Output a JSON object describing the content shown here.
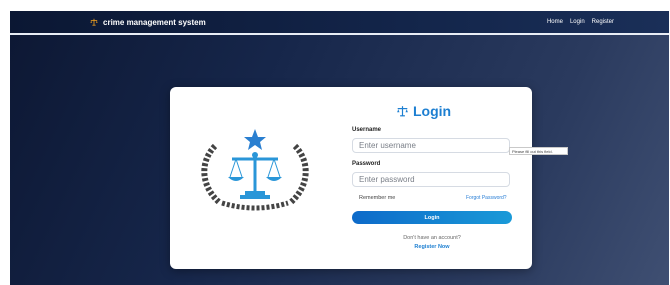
{
  "navbar": {
    "brand": "crime management system",
    "links": [
      "Home",
      "Login",
      "Register"
    ]
  },
  "login": {
    "title": "Login",
    "username_label": "Username",
    "username_placeholder": "Enter username",
    "password_label": "Password",
    "password_placeholder": "Enter password",
    "remember_label": "Remember me",
    "forgot_label": "Forgot Password?",
    "button_label": "Login",
    "no_account_text": "Don't have an account?",
    "register_label": "Register Now"
  },
  "tooltip": {
    "text": "Please fill out this field."
  },
  "colors": {
    "accent": "#1d7fd1",
    "navbar": "#0b1733",
    "button": "#0d6ac9"
  },
  "icons": {
    "brand": "scales-icon",
    "title": "scales-icon",
    "emblem": "justice-emblem-icon"
  }
}
